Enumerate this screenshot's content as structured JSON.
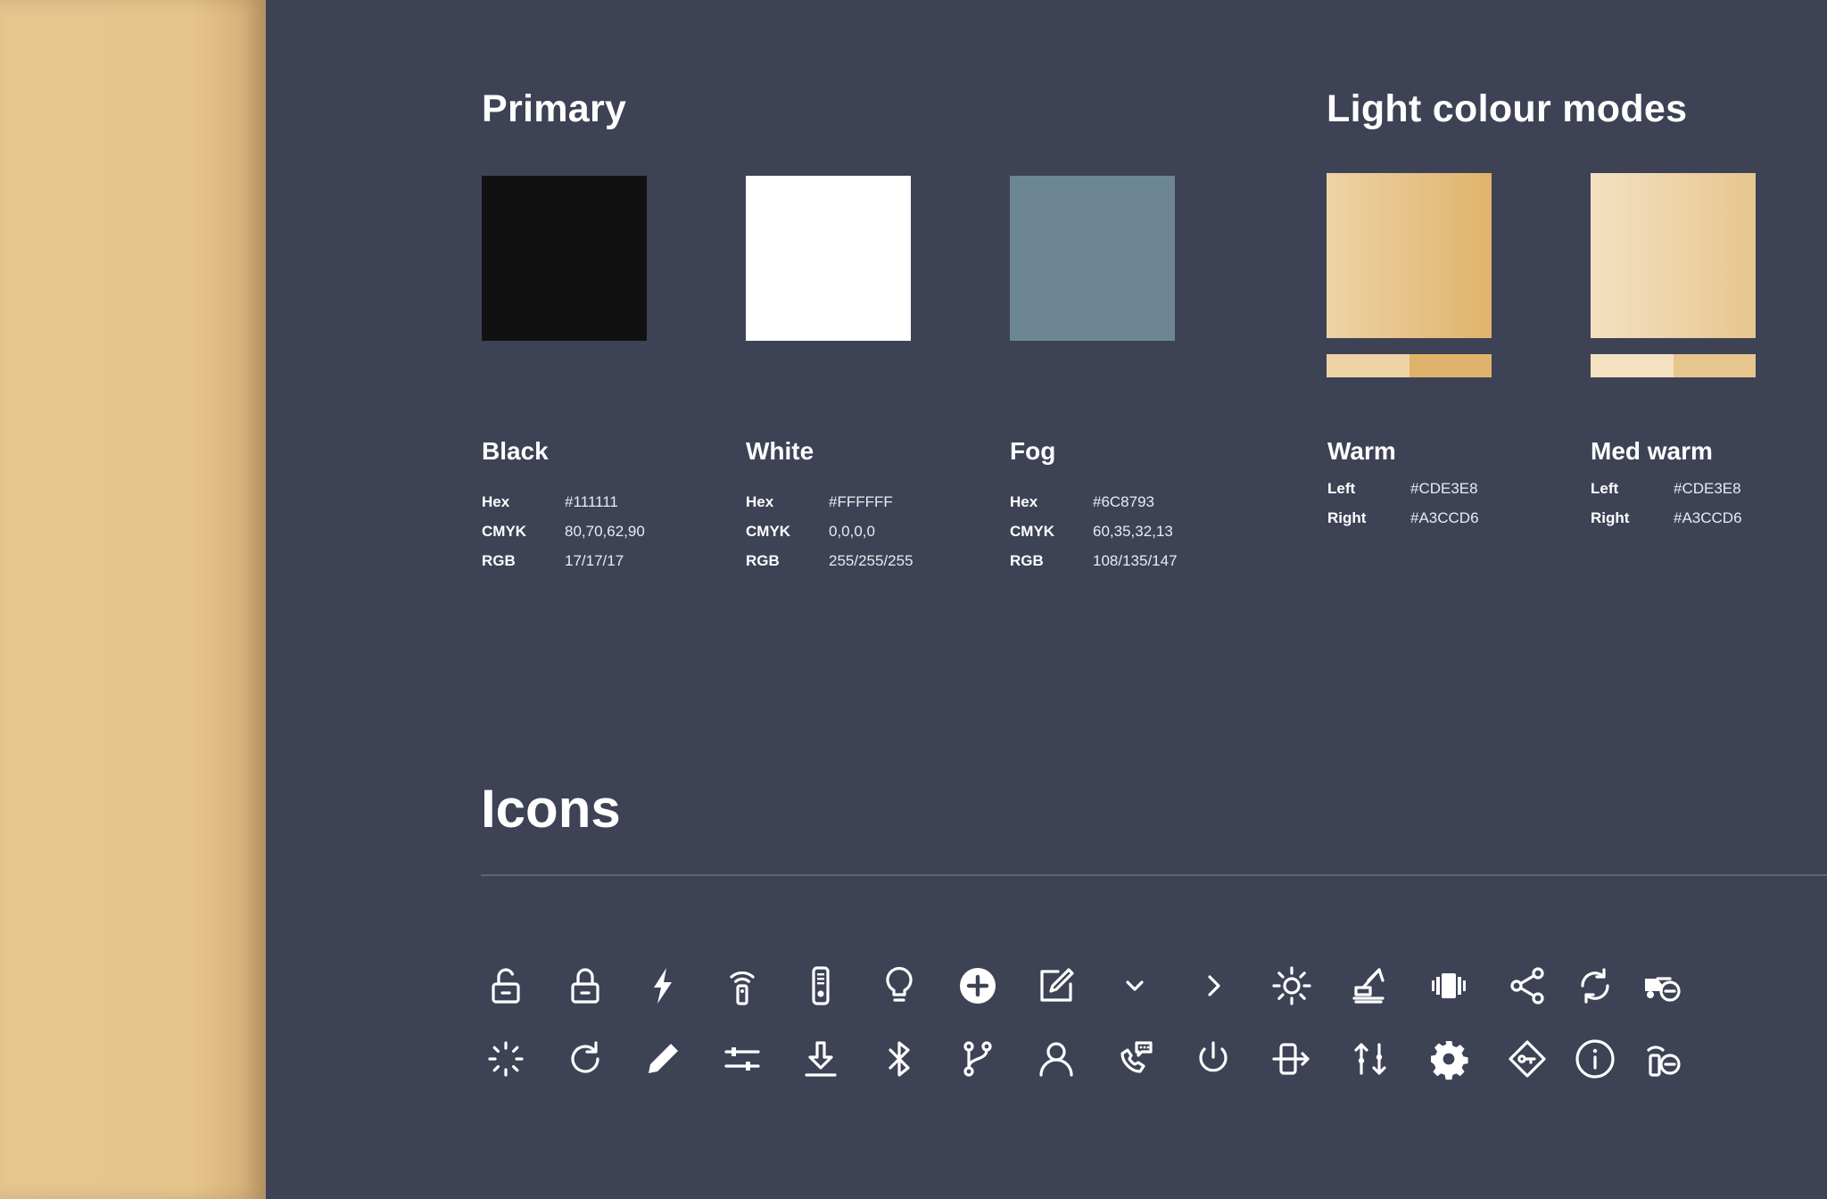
{
  "sections": {
    "primary": "Primary",
    "light_modes": "Light colour modes",
    "icons": "Icons"
  },
  "primary_colors": [
    {
      "name": "Black",
      "color": "#111111",
      "specs": [
        {
          "k": "Hex",
          "v": "#111111"
        },
        {
          "k": "CMYK",
          "v": "80,70,62,90"
        },
        {
          "k": "RGB",
          "v": "17/17/17"
        }
      ]
    },
    {
      "name": "White",
      "color": "#FFFFFF",
      "specs": [
        {
          "k": "Hex",
          "v": "#FFFFFF"
        },
        {
          "k": "CMYK",
          "v": "0,0,0,0"
        },
        {
          "k": "RGB",
          "v": "255/255/255"
        }
      ]
    },
    {
      "name": "Fog",
      "color": "#6C8793",
      "specs": [
        {
          "k": "Hex",
          "v": "#6C8793"
        },
        {
          "k": "CMYK",
          "v": "60,35,32,13"
        },
        {
          "k": "RGB",
          "v": "108/135/147"
        }
      ]
    }
  ],
  "light_modes": [
    {
      "name": "Warm",
      "gradient_left": "#EDD3A6",
      "gradient_right": "#DFB36B",
      "specs": [
        {
          "k": "Left",
          "v": "#CDE3E8"
        },
        {
          "k": "Right",
          "v": "#A3CCD6"
        }
      ]
    },
    {
      "name": "Med warm",
      "gradient_left": "#F3E1C2",
      "gradient_right": "#E7C68E",
      "specs": [
        {
          "k": "Left",
          "v": "#CDE3E8"
        },
        {
          "k": "Right",
          "v": "#A3CCD6"
        }
      ]
    }
  ],
  "icon_rows": [
    [
      "unlock-icon",
      "lock-icon",
      "lightning-icon",
      "remote-signal-icon",
      "remote-control-icon",
      "lightbulb-icon",
      "add-circle-icon",
      "edit-box-icon",
      "chevron-down-icon",
      "chevron-right-icon",
      "sun-icon",
      "crane-icon",
      "vibration-icon",
      "share-icon",
      "sync-icon",
      "truck-minus-icon"
    ],
    [
      "loading-icon",
      "refresh-icon",
      "pencil-icon",
      "sliders-icon",
      "download-icon",
      "bluetooth-icon",
      "branch-icon",
      "user-icon",
      "phone-chat-icon",
      "power-icon",
      "exit-icon",
      "sort-icon",
      "gear-icon",
      "key-tag-icon",
      "info-icon",
      "remote-minus-icon"
    ]
  ]
}
